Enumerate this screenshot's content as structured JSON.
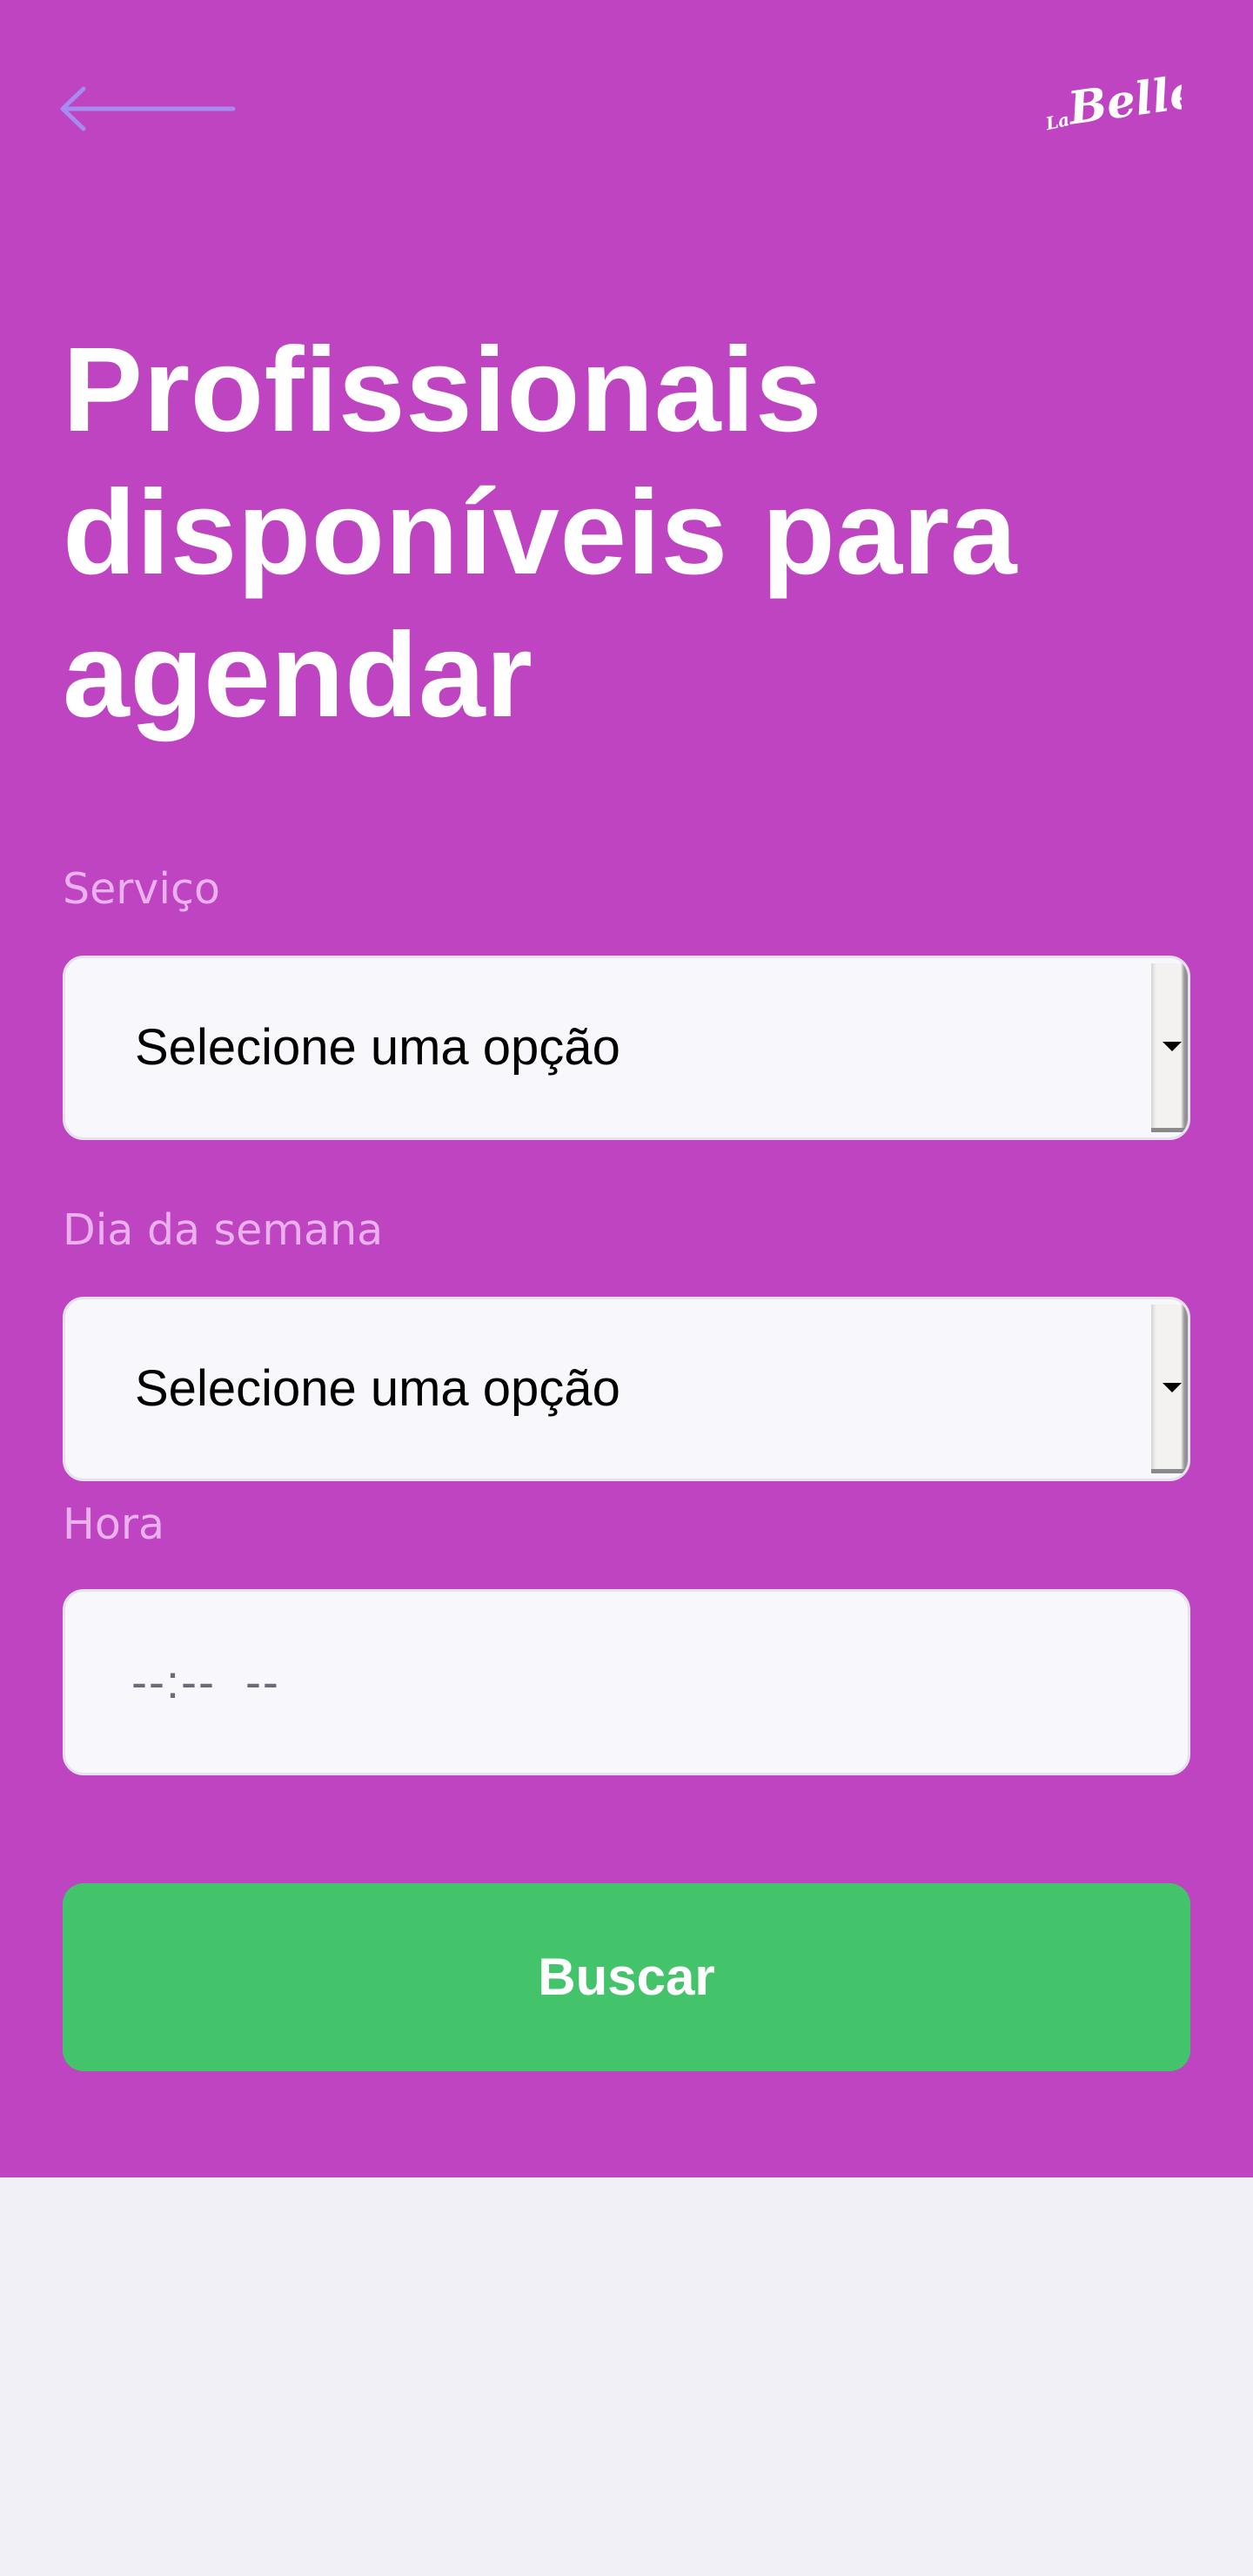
{
  "header": {
    "back_icon": "arrow-left-icon",
    "logo_text": "LaBelle"
  },
  "title": {
    "line1": "Profissionais",
    "line2": "disponíveis para",
    "line3": "agendar"
  },
  "form": {
    "service": {
      "label": "Serviço",
      "value": "Selecione uma opção"
    },
    "weekday": {
      "label": "Dia da semana",
      "value": "Selecione uma opção"
    },
    "time": {
      "label": "Hora",
      "placeholder": "--:--  --"
    },
    "submit_label": "Buscar"
  },
  "colors": {
    "hero_background": "#be44c1",
    "page_background": "#f0f0f6",
    "button_green": "#43c46b",
    "back_arrow": "#a88bf0",
    "label_color": "#ebb0ee"
  }
}
